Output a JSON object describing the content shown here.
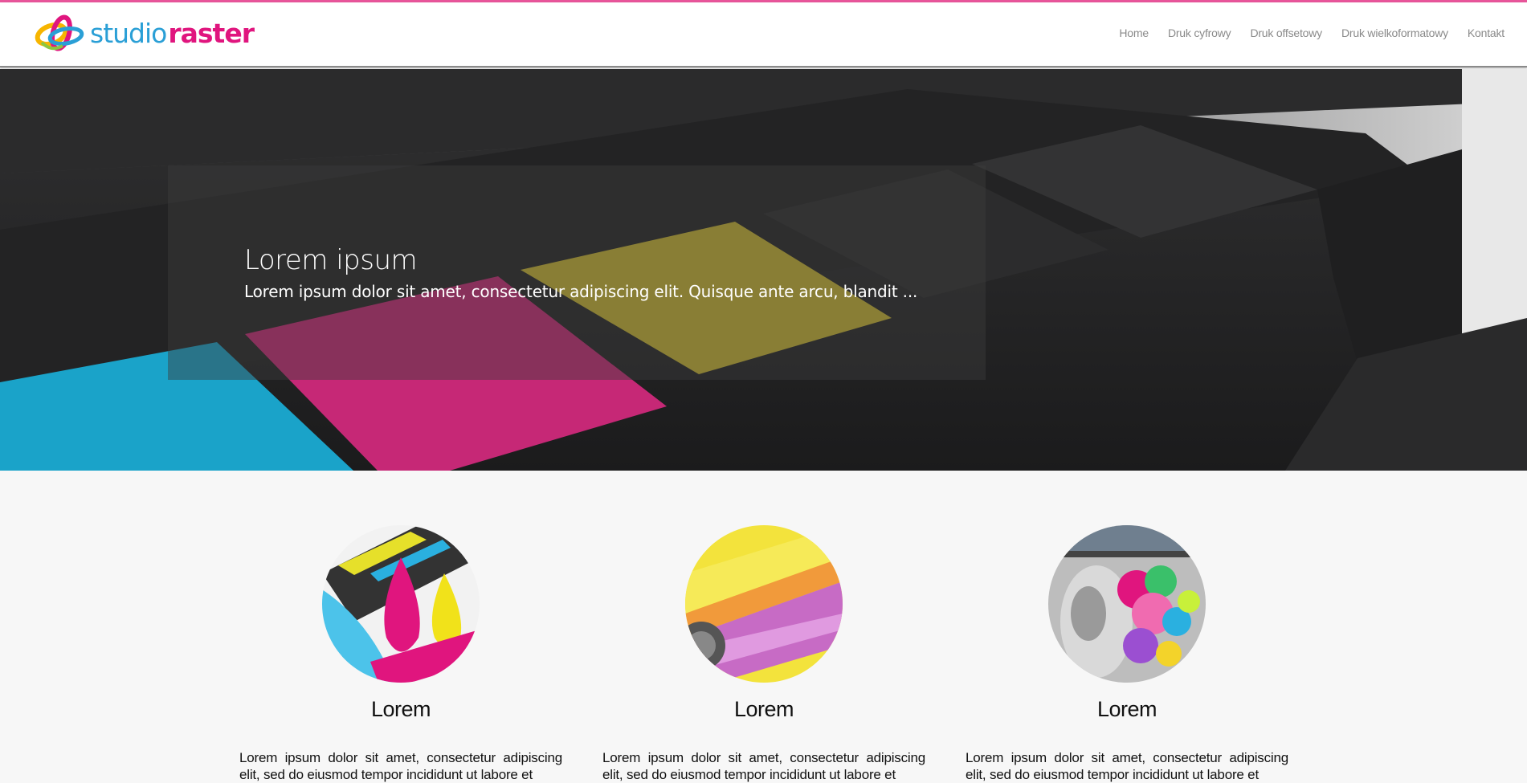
{
  "brand": {
    "name_part1": "studio",
    "name_part2": "raster",
    "accent_pink": "#e0157e",
    "accent_blue": "#2a9fd6",
    "logo_icon": "interlocked-rings-logo"
  },
  "nav": {
    "items": [
      {
        "label": "Home"
      },
      {
        "label": "Druk cyfrowy"
      },
      {
        "label": "Druk offsetowy"
      },
      {
        "label": "Druk wielkoformatowy"
      },
      {
        "label": "Kontakt"
      }
    ]
  },
  "hero": {
    "title": "Lorem ipsum",
    "text": "Lorem ipsum dolor sit amet, consectetur adipiscing elit. Quisque ante arcu, blandit ...",
    "image_icon": "cmyk-ink-cartridges-image"
  },
  "features": [
    {
      "title": "Lorem",
      "text": "Lorem ipsum dolor sit amet, consectetur adipiscing elit, sed do eiusmod tempor incididunt ut labore et",
      "image_icon": "ink-drops-image"
    },
    {
      "title": "Lorem",
      "text": "Lorem ipsum dolor sit amet, consectetur adipiscing elit, sed do eiusmod tempor incididunt ut labore et",
      "image_icon": "print-rollers-image"
    },
    {
      "title": "Lorem",
      "text": "Lorem ipsum dolor sit amet, consectetur adipiscing elit, sed do eiusmod tempor incididunt ut labore et",
      "image_icon": "large-format-printer-image"
    }
  ]
}
